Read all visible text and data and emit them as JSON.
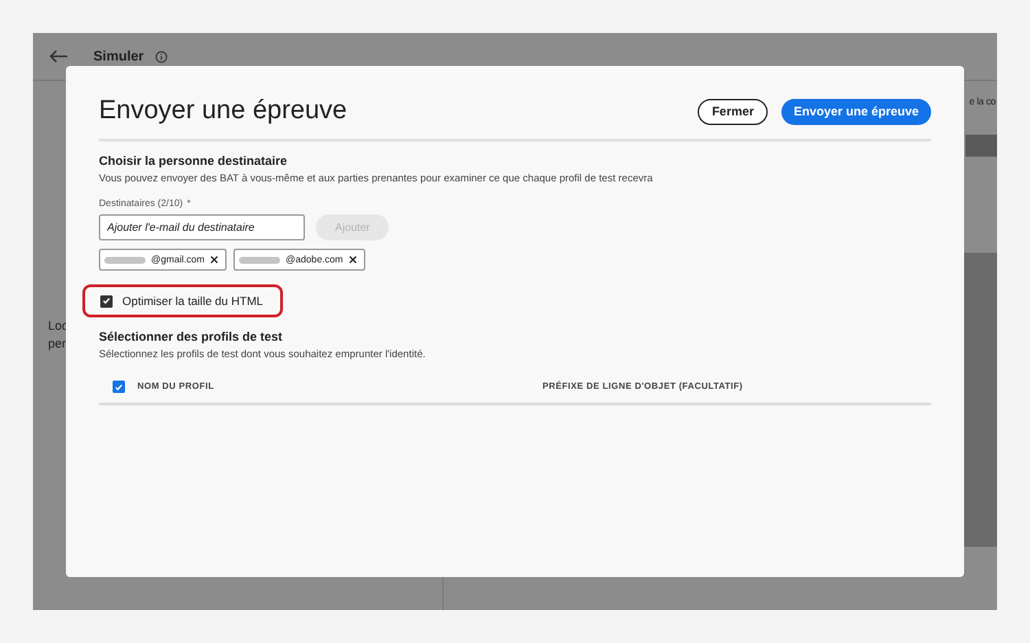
{
  "app": {
    "title": "Simuler",
    "left_text": [
      "Loc",
      "per"
    ],
    "right_text": "e la co"
  },
  "dialog": {
    "title": "Envoyer une épreuve",
    "buttons": [
      {
        "label": "Fermer",
        "kind": "secondary"
      },
      {
        "label": "Envoyer une épreuve",
        "kind": "primary"
      }
    ],
    "recipients": {
      "heading": "Choisir la personne destinataire",
      "description": "Vous pouvez envoyer des BAT à vous-même et aux parties prenantes pour examiner ce que chaque profil de test recevra",
      "field_label": "Destinataires (2/10)",
      "required_mark": "*",
      "placeholder": "Ajouter l'e-mail du destinataire",
      "add_button": {
        "label": "Ajouter",
        "disabled": true
      },
      "tags": [
        {
          "domain": "@gmail.com"
        },
        {
          "domain": "@adobe.com"
        }
      ]
    },
    "optimize": {
      "label": "Optimiser la taille du HTML",
      "checked": true,
      "highlighted": true
    },
    "profiles": {
      "heading": "Sélectionner des profils de test",
      "description": "Sélectionnez les profils de test dont vous souhaitez emprunter l'identité.",
      "select_all": {
        "checked": true
      },
      "columns": [
        "NOM DU PROFIL",
        "PRÉFIXE DE LIGNE D'OBJET (FACULTATIF)"
      ]
    }
  }
}
